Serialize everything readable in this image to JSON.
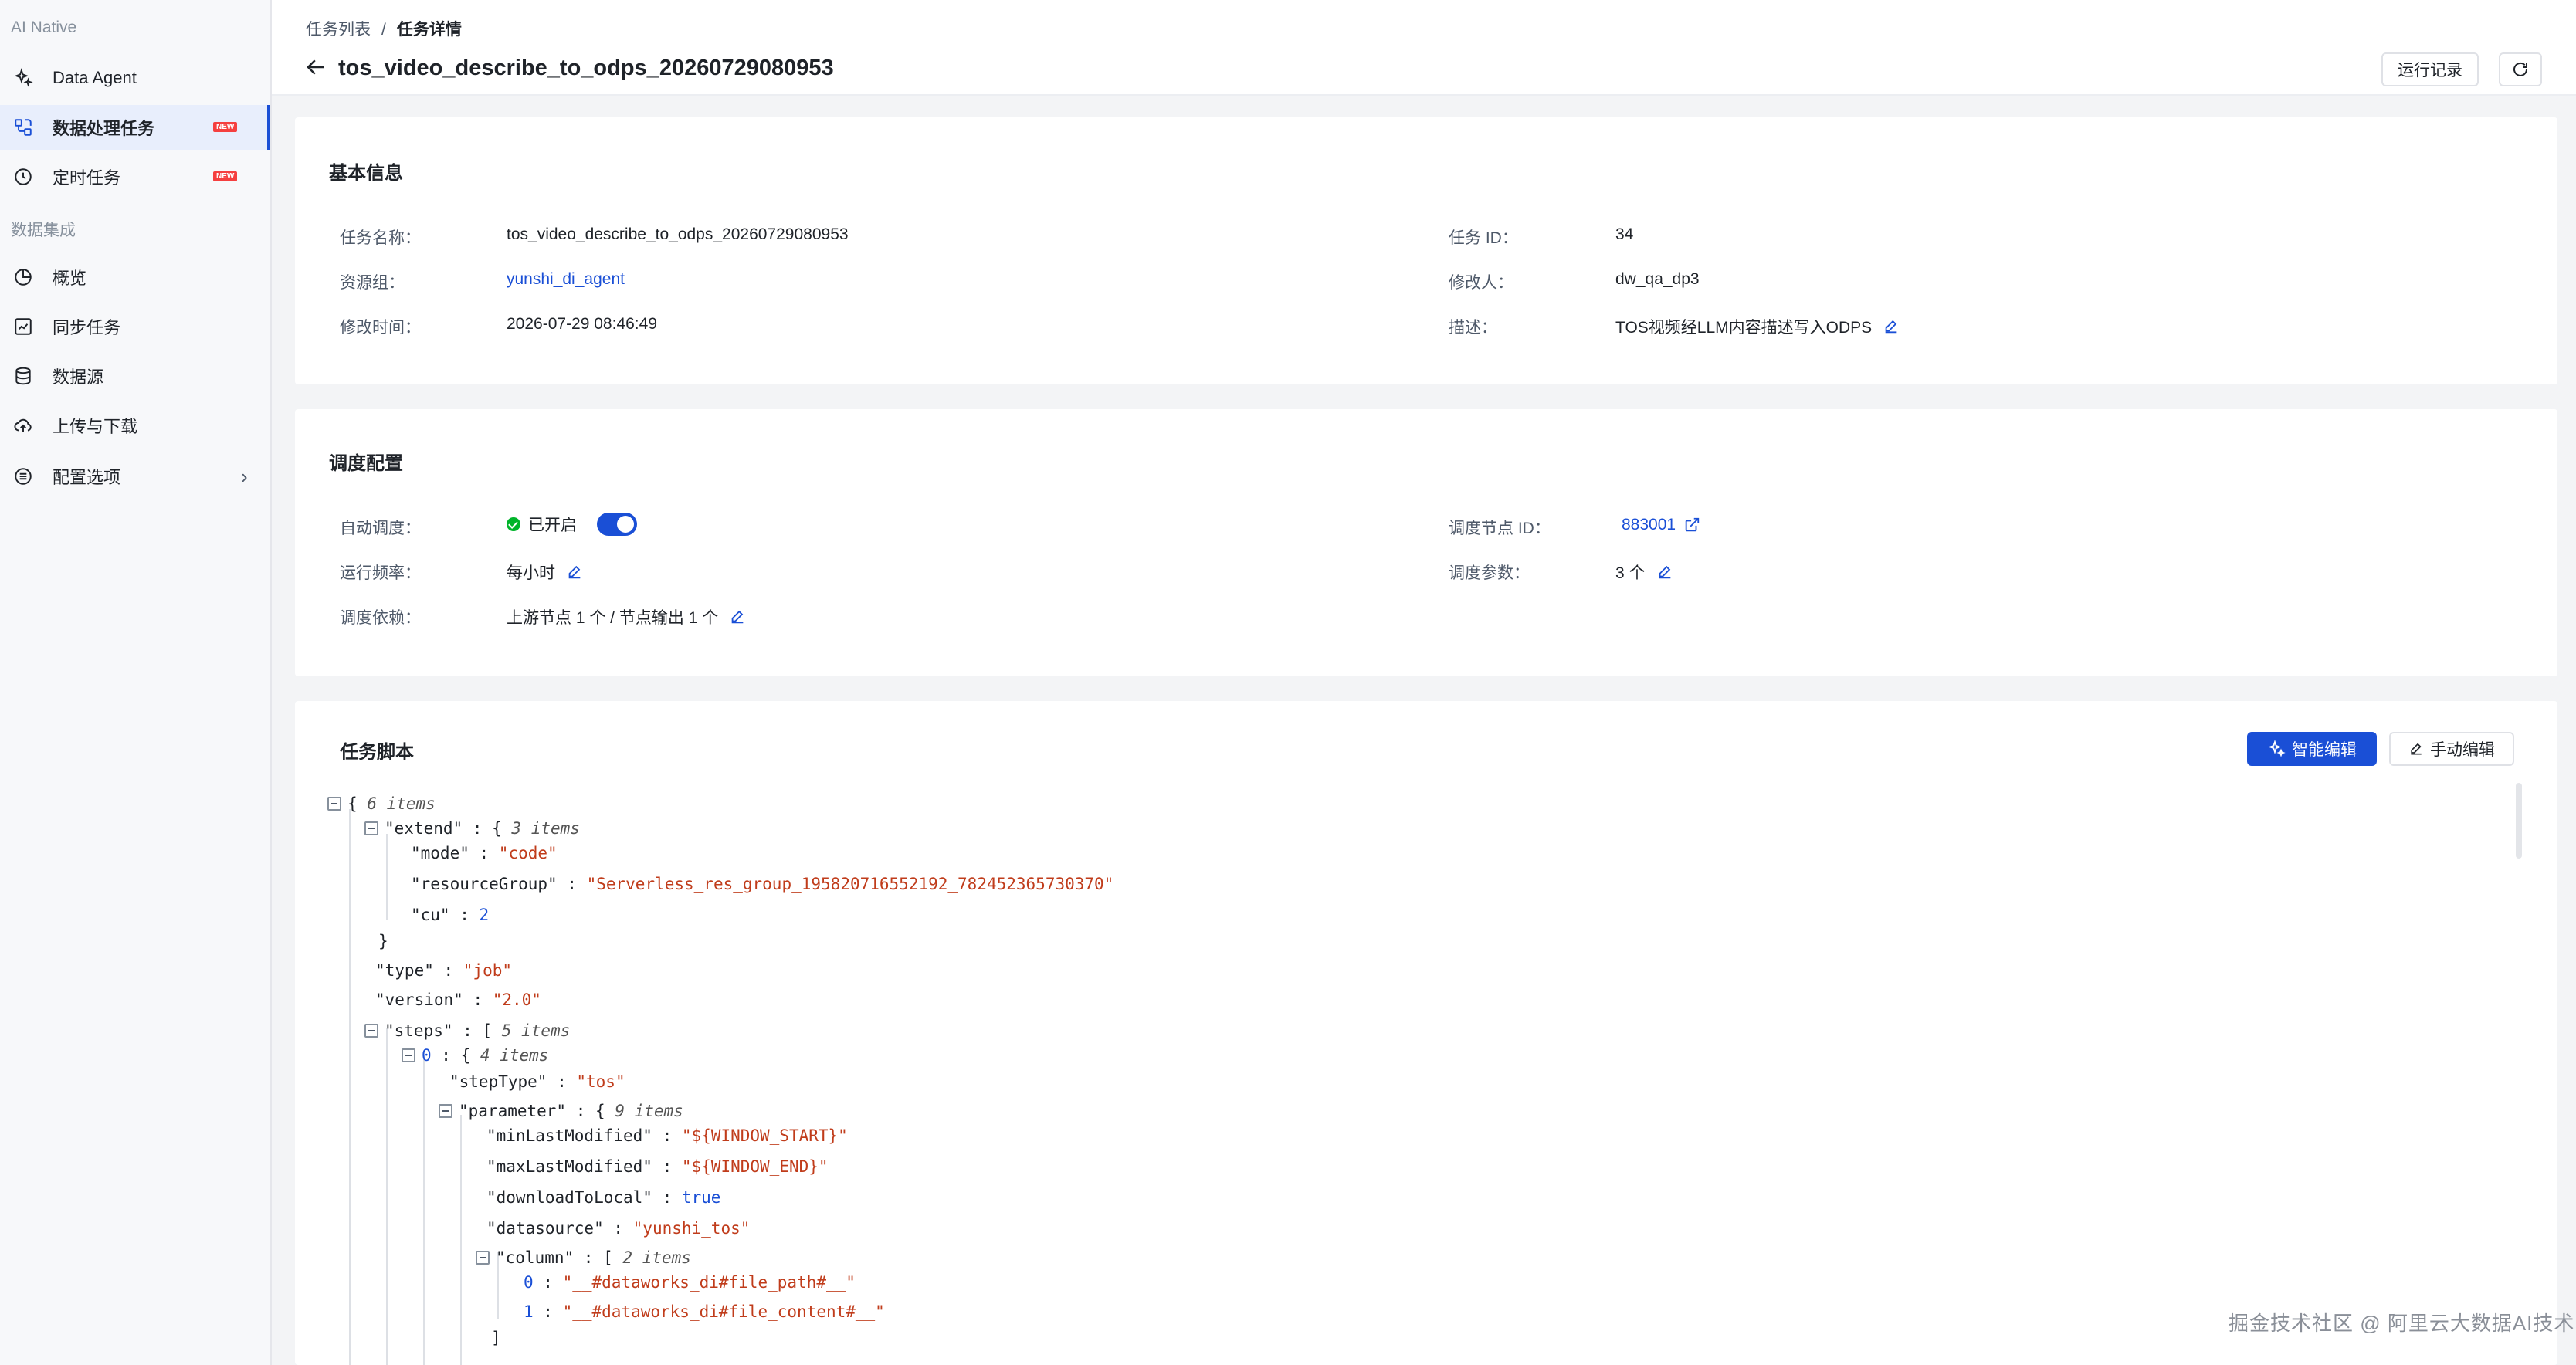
{
  "sidebar": {
    "group_ai": "AI Native",
    "item_agent": "Data Agent",
    "item_tasks": "数据处理任务",
    "item_scheduled": "定时任务",
    "badge_new": "NEW",
    "group_integration": "数据集成",
    "item_overview": "概览",
    "item_sync": "同步任务",
    "item_datasource": "数据源",
    "item_upload": "上传与下载",
    "item_config": "配置选项"
  },
  "header": {
    "crumb_list": "任务列表",
    "crumb_sep": "/",
    "crumb_detail": "任务详情",
    "title": "tos_video_describe_to_odps_20260729080953",
    "btn_history": "运行记录"
  },
  "basic": {
    "title": "基本信息",
    "name_label": "任务名称：",
    "name_value": "tos_video_describe_to_odps_20260729080953",
    "group_label": "资源组：",
    "group_value": "yunshi_di_agent",
    "mtime_label": "修改时间：",
    "mtime_value": "2026-07-29 08:46:49",
    "id_label": "任务 ID：",
    "id_value": "34",
    "modifier_label": "修改人：",
    "modifier_value": "dw_qa_dp3",
    "desc_label": "描述：",
    "desc_value": "TOS视频经LLM内容描述写入ODPS"
  },
  "schedule": {
    "title": "调度配置",
    "auto_label": "自动调度：",
    "auto_value": "已开启",
    "freq_label": "运行频率：",
    "freq_value": "每小时",
    "dep_label": "调度依赖：",
    "dep_value": "上游节点 1 个 / 节点输出 1 个",
    "node_label": "调度节点 ID：",
    "node_value": "883001",
    "params_label": "调度参数：",
    "params_value": "3 个"
  },
  "script": {
    "title": "任务脚本",
    "btn_ai_edit": "智能编辑",
    "btn_manual_edit": "手动编辑",
    "lines": {
      "root_brace": "{",
      "root_count": "6 items",
      "extend_key": "\"extend\"",
      "extend_open": "{",
      "extend_count": "3 items",
      "mode_key": "\"mode\"",
      "mode_val": "\"code\"",
      "rg_key": "\"resourceGroup\"",
      "rg_val": "\"Serverless_res_group_195820716552192_782452365730370\"",
      "cu_key": "\"cu\"",
      "cu_val": "2",
      "extend_close": "}",
      "type_key": "\"type\"",
      "type_val": "\"job\"",
      "version_key": "\"version\"",
      "version_val": "\"2.0\"",
      "steps_key": "\"steps\"",
      "steps_open": "[",
      "steps_count": "5 items",
      "step0_idx": "0",
      "step0_open": "{",
      "step0_count": "4 items",
      "steptype_key": "\"stepType\"",
      "steptype_val": "\"tos\"",
      "param_key": "\"parameter\"",
      "param_open": "{",
      "param_count": "9 items",
      "minlm_key": "\"minLastModified\"",
      "minlm_val": "\"${WINDOW_START}\"",
      "maxlm_key": "\"maxLastModified\"",
      "maxlm_val": "\"${WINDOW_END}\"",
      "dl_key": "\"downloadToLocal\"",
      "dl_val": "true",
      "ds_key": "\"datasource\"",
      "ds_val": "\"yunshi_tos\"",
      "col_key": "\"column\"",
      "col_open": "[",
      "col_count": "2 items",
      "col0_idx": "0",
      "col0_val": "\"__#dataworks_di#file_path#__\"",
      "col1_idx": "1",
      "col1_val": "\"__#dataworks_di#file_content#__\"",
      "col_close": "]"
    }
  },
  "watermark": "掘金技术社区 @ 阿里云大数据AI技术",
  "colors": {
    "primary": "#1a4fd6",
    "string": "#c03c1b",
    "success": "#00b42a",
    "badge": "#f53f3f"
  }
}
